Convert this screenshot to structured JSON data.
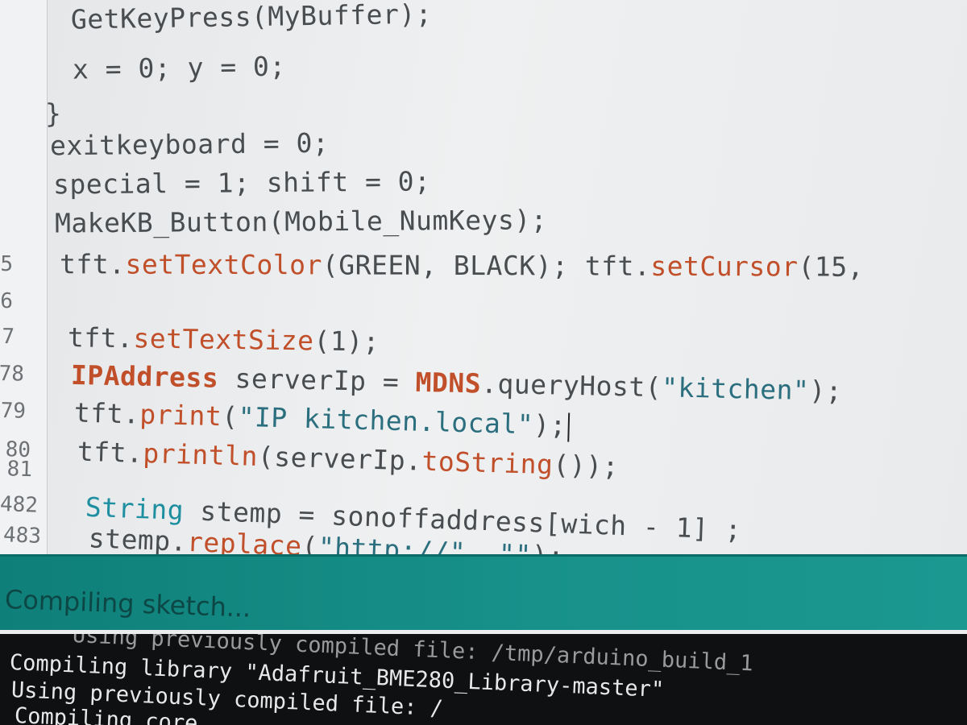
{
  "editor": {
    "lines": [
      {
        "num": "",
        "code": "GetKeyPress(MyBuffer);"
      },
      {
        "num": "",
        "code": "x = 0; y = 0;"
      },
      {
        "num": "",
        "code": "}"
      },
      {
        "num": "",
        "code": "exitkeyboard = 0;"
      },
      {
        "num": "",
        "code": "special = 1; shift = 0;"
      },
      {
        "num": "",
        "code": "MakeKB_Button(Mobile_NumKeys);"
      },
      {
        "num": "5",
        "code": "tft.setTextColor(GREEN, BLACK); tft.setCursor(15,"
      },
      {
        "num": "6",
        "code": ""
      },
      {
        "num": "7",
        "code": "tft.setTextSize(1);"
      },
      {
        "num": "78",
        "code": "IPAddress serverIp = MDNS.queryHost(\"kitchen\");"
      },
      {
        "num": "79",
        "code": "tft.print(\"IP kitchen.local\");"
      },
      {
        "num": "80",
        "code": "tft.println(serverIp.toString());"
      },
      {
        "num": "81",
        "code": ""
      },
      {
        "num": "482",
        "code": "String stemp = sonoffaddress[wich - 1] ;"
      },
      {
        "num": "483",
        "code": "stemp.replace(\"http://\", \"\");"
      }
    ]
  },
  "status": {
    "text": "Compiling sketch..."
  },
  "console": {
    "lines": [
      "Using previously compiled file: /tmp/arduino_build_1",
      "Compiling library \"Adafruit_BME280_Library-master\"",
      "Using previously compiled file: /",
      "Compiling core..."
    ]
  },
  "colors": {
    "status_bar": "#19867f",
    "console_bg": "#0e1012",
    "keyword_orange": "#c04f2a",
    "keyword_teal": "#1e8fa0"
  }
}
